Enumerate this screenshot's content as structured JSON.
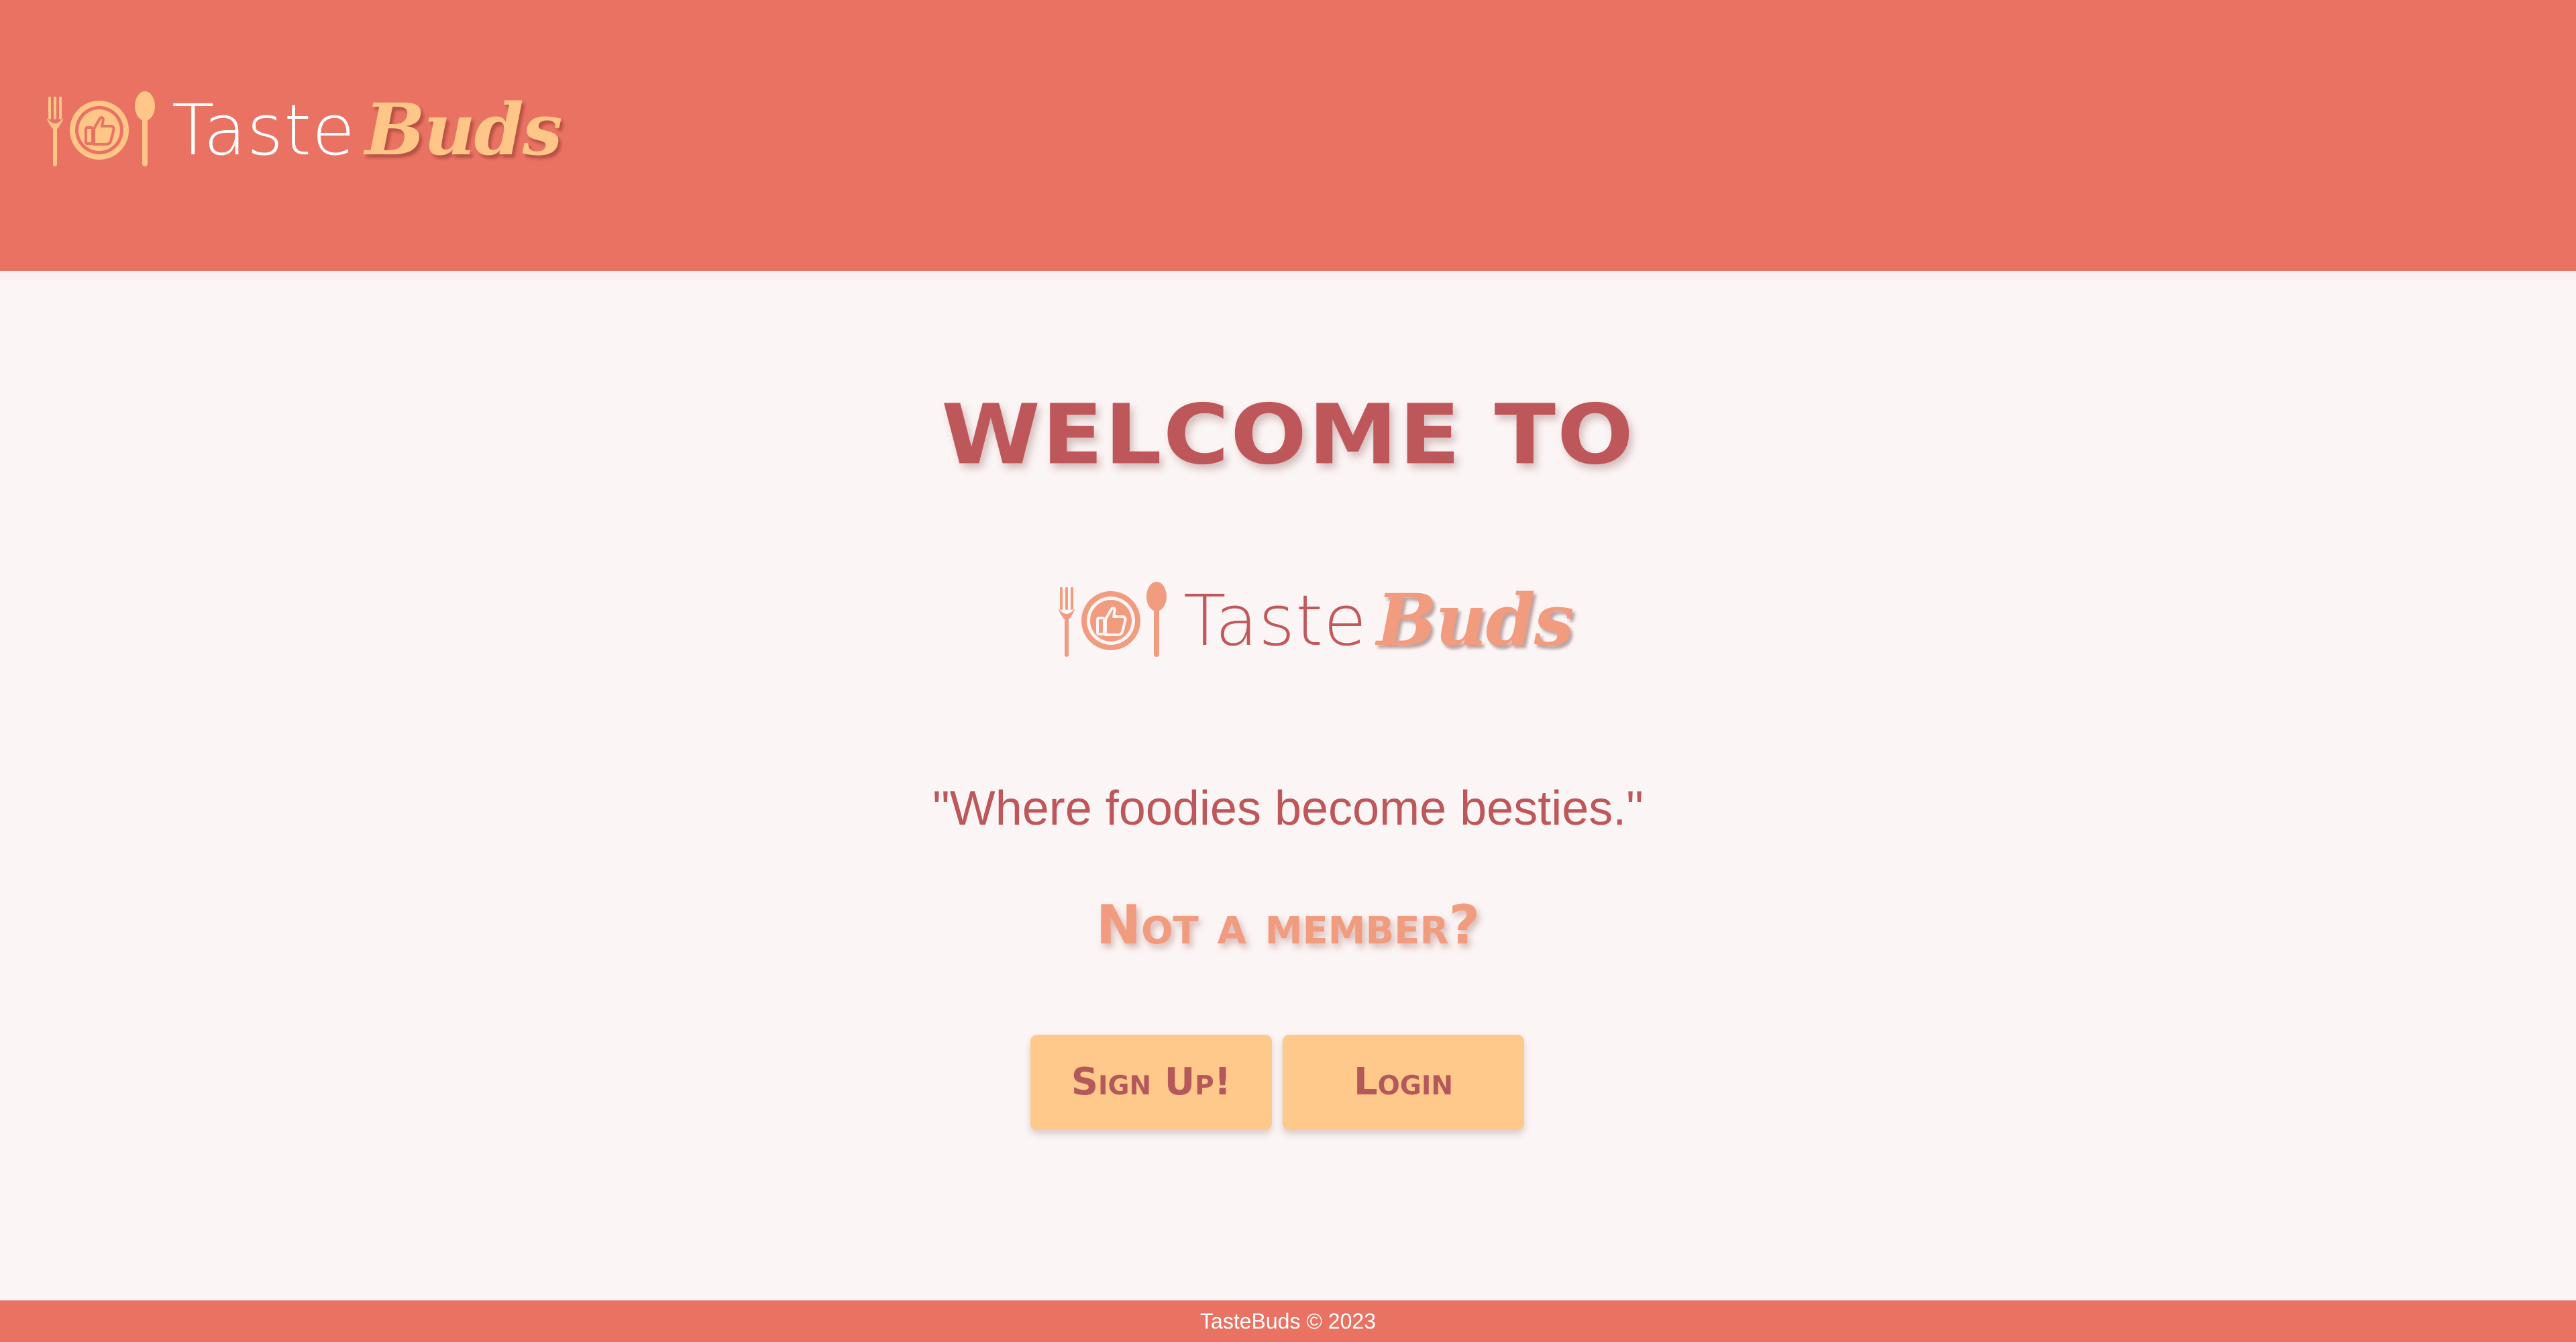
{
  "header": {
    "logo": {
      "text_taste": "Taste",
      "text_buds": "Buds"
    }
  },
  "main": {
    "welcome": "WELCOME TO",
    "logo": {
      "text_taste": "Taste",
      "text_buds": "Buds"
    },
    "tagline": "\"Where foodies become besties.\"",
    "not_member": "Not a member?",
    "signup_label": "Sign Up!",
    "login_label": "Login"
  },
  "footer": {
    "text": "TasteBuds © 2023"
  },
  "icons": {
    "logo_icon": "fork-plate-thumbs-up-spoon-icon"
  },
  "colors": {
    "header_bg": "#ea7262",
    "page_bg": "#fcf5f5",
    "heading": "#bd5759",
    "accent_orange": "#ffc688",
    "accent_salmon": "#f19b7f",
    "button_bg": "#ffc98c"
  }
}
